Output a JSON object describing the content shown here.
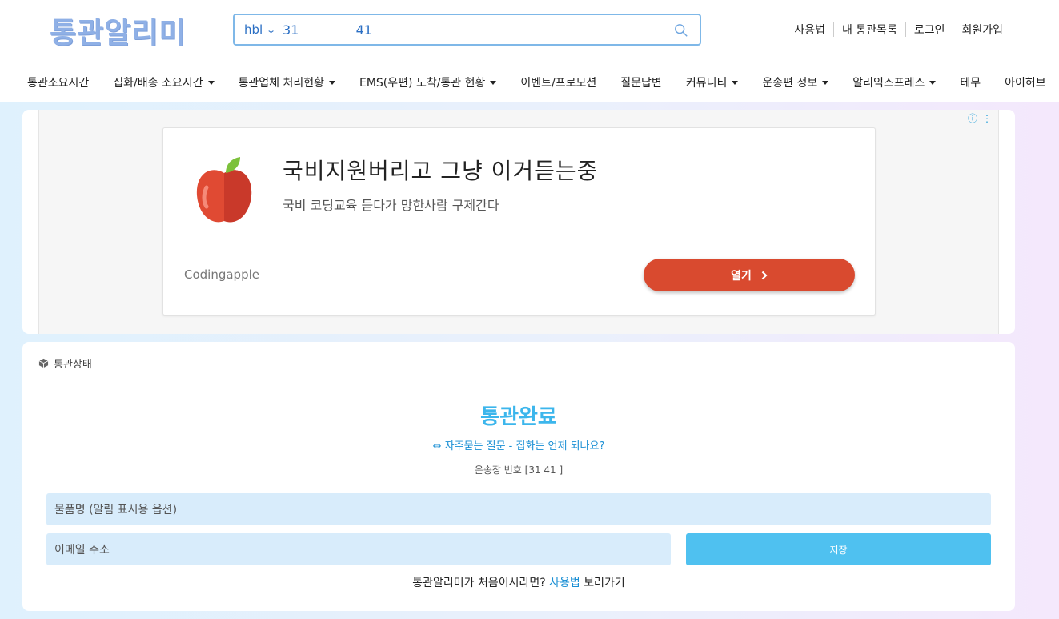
{
  "header": {
    "logo": "통관알리미",
    "search": {
      "type": "hbl",
      "value": "31              41"
    },
    "links": [
      "사용법",
      "내 통관목록",
      "로그인",
      "회원가입"
    ]
  },
  "nav": {
    "items": [
      {
        "label": "통관소요시간",
        "dropdown": false
      },
      {
        "label": "집화/배송 소요시간",
        "dropdown": true
      },
      {
        "label": "통관업체 처리현황",
        "dropdown": true
      },
      {
        "label": "EMS(우편) 도착/통관 현황",
        "dropdown": true
      },
      {
        "label": "이벤트/프로모션",
        "dropdown": false
      },
      {
        "label": "질문답변",
        "dropdown": false
      },
      {
        "label": "커뮤니티",
        "dropdown": true
      },
      {
        "label": "운송편 정보",
        "dropdown": true
      },
      {
        "label": "알리익스프레스",
        "dropdown": true
      },
      {
        "label": "테무",
        "dropdown": false
      },
      {
        "label": "아이허브",
        "dropdown": false
      }
    ]
  },
  "ad": {
    "title": "국비지원버리고 그냥 이거듣는중",
    "description": "국비 코딩교육 듣다가 망한사람 구제간다",
    "brand": "Codingapple",
    "open_label": "열기",
    "info_icon": "ⓘ",
    "more_icon": "⋮"
  },
  "status": {
    "header": "통관상태",
    "title": "통관완료",
    "faq": "자주묻는 질문 - 집화는 언제 되나요?",
    "tracking": "운송장 번호 [31               41 ]",
    "item_placeholder": "물품명 (알림 표시용 옵션)",
    "email_placeholder": "이메일 주소",
    "save_label": "저장",
    "note_prefix": "통관알리미가 처음이시라면?",
    "note_link": "사용법",
    "note_suffix": "보러가기"
  },
  "colors": {
    "accent": "#3cb6ec",
    "link": "#1a8fd4",
    "ad_button": "#d94a2f",
    "logo": "#8fb0e6"
  }
}
